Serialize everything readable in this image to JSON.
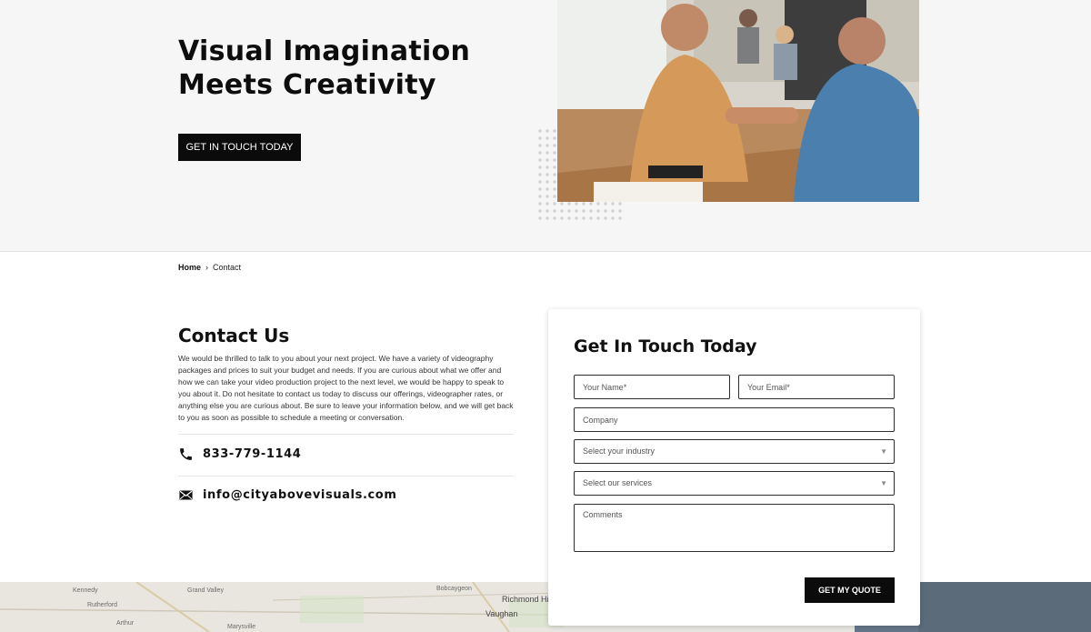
{
  "hero": {
    "title": "Visual Imagination Meets Creativity",
    "cta_label": "GET IN TOUCH TODAY",
    "photo": "handshake-meeting-photo"
  },
  "breadcrumb": {
    "home": "Home",
    "separator": "›",
    "current": "Contact"
  },
  "contact": {
    "title": "Contact Us",
    "description": "We would be thrilled to talk to you about your next project. We have a variety of videography packages and prices to suit your budget and needs. If you are curious about what we offer and how we can take your video production project to the next level, we would be happy to speak to you about it. Do not hesitate to contact us today to discuss our offerings, videographer rates, or anything else you are curious about. Be sure to leave your information below, and we will get back to you as soon as possible to schedule a meeting or conversation.",
    "phone": "833-779-1144",
    "email": "info@cityabovevisuals.com",
    "phone_icon": "phone-icon",
    "email_icon": "envelope-icon"
  },
  "form": {
    "title": "Get In Touch Today",
    "name_placeholder": "Your Name*",
    "email_placeholder": "Your Email*",
    "company_placeholder": "Company",
    "industry_label": "Select your industry",
    "services_label": "Select our services",
    "comments_placeholder": "Comments",
    "submit_label": "GET MY QUOTE"
  },
  "map": {
    "labels": [
      "Kennedy",
      "Rutherford",
      "Grand Valley",
      "Richmond Hill",
      "Vaughan",
      "Marysville",
      "Bobcaygeon",
      "Arthur"
    ]
  },
  "colors": {
    "accent": "#0b0b0b",
    "hero_bg": "#f6f6f6",
    "map_water": "#5b6b7a"
  }
}
